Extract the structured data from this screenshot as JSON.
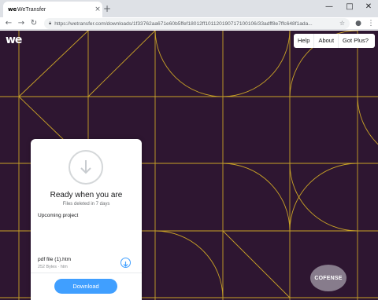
{
  "browser": {
    "tab_icon": "we",
    "tab_title": "WeTransfer",
    "tab_close": "×",
    "new_tab": "+",
    "minimize": "—",
    "maximize": "□",
    "close": "✕",
    "url": "https://wetransfer.com/downloads/1f33762aa671e60b5ffef18012ff10112019071710010​6/33adff8e7ffc648f1ada...",
    "back_icon": "arrow-left-icon",
    "forward_icon": "arrow-right-icon",
    "reload_icon": "reload-icon",
    "lock_icon": "lock-icon",
    "star_icon": "star-icon",
    "account_icon": "account-icon",
    "menu_icon": "kebab-menu-icon"
  },
  "page": {
    "logo": "we",
    "menu": [
      "Help",
      "About",
      "Got Plus?"
    ],
    "card": {
      "title": "Ready when you are",
      "subtitle": "Files deleted in 7 days",
      "project": "Upcoming project",
      "file_name": "pdf file (1).htm",
      "file_meta": "252 Bytes · htm",
      "download_label": "Download"
    },
    "watermark": "COFENSE",
    "colors": {
      "background": "#2e1631",
      "lines": "#c9a227",
      "accent": "#409fff"
    }
  }
}
